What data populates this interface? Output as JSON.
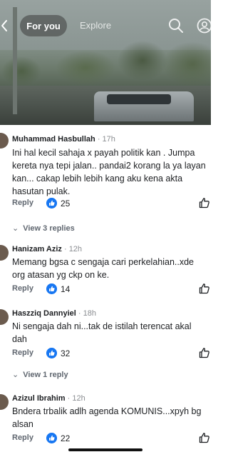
{
  "header": {
    "tabs": [
      {
        "label": "For you",
        "active": true
      },
      {
        "label": "Explore",
        "active": false
      }
    ],
    "icons": [
      "back-icon",
      "search-icon",
      "profile-icon"
    ]
  },
  "comments": [
    {
      "author": "Muhammad Hasbullah",
      "age": "17h",
      "text": "Ini hal kecil sahaja x payah politik kan . Jumpa kereta nya tepi jalan.. pandai2 korang la ya layan kan... cakap lebih lebih kang aku kena akta hasutan pulak.",
      "reply_label": "Reply",
      "reaction_count": "25",
      "view_replies": "View 3 replies"
    },
    {
      "author": "Hanizam Aziz",
      "age": "12h",
      "text": "Memang bgsa c sengaja cari perkelahian..xde org atasan yg ckp on ke.",
      "reply_label": "Reply",
      "reaction_count": "14"
    },
    {
      "author": "Haszziq Dannyiel",
      "age": "18h",
      "text": "Ni sengaja dah ni...tak de istilah terencat akal dah",
      "reply_label": "Reply",
      "reaction_count": "32",
      "view_replies": "View 1 reply"
    },
    {
      "author": "Azizul Ibrahim",
      "age": "12h",
      "text": "Bndera trbalik adlh agenda KOMUNIS...xpyh bg alsan",
      "reply_label": "Reply",
      "reaction_count": "22"
    }
  ],
  "colors": {
    "reaction_blue": "#1877f2",
    "meta_gray": "#8a8d91"
  }
}
